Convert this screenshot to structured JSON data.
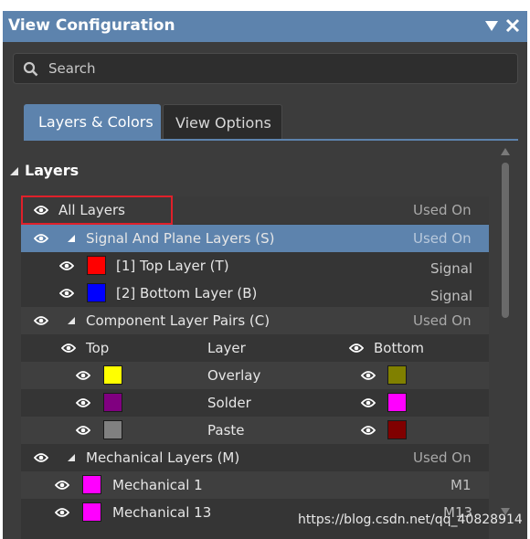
{
  "window": {
    "title": "View Configuration",
    "dropdown_icon": "triangle-down-icon",
    "close_icon": "close-icon"
  },
  "search": {
    "placeholder": "Search",
    "icon": "search-icon"
  },
  "tabs": [
    {
      "label": "Layers & Colors",
      "active": true
    },
    {
      "label": "View Options",
      "active": false
    }
  ],
  "section": {
    "label": "Layers"
  },
  "all_layers": {
    "label": "All Layers",
    "right": "Used On"
  },
  "signal_group": {
    "label": "Signal And Plane Layers (S)",
    "right": "Used On",
    "items": [
      {
        "label": "[1] Top Layer (T)",
        "color": "#ff0000",
        "type": "Signal"
      },
      {
        "label": "[2] Bottom Layer (B)",
        "color": "#0000ff",
        "type": "Signal"
      }
    ]
  },
  "component_group": {
    "label": "Component Layer Pairs (C)",
    "right": "Used On",
    "headers": {
      "top": "Top",
      "layer": "Layer",
      "bottom": "Bottom"
    },
    "pairs": [
      {
        "layer": "Overlay",
        "top_color": "#ffff00",
        "bottom_color": "#808000"
      },
      {
        "layer": "Solder",
        "top_color": "#800080",
        "bottom_color": "#ff00ff"
      },
      {
        "layer": "Paste",
        "top_color": "#808080",
        "bottom_color": "#800000"
      }
    ]
  },
  "mechanical_group": {
    "label": "Mechanical Layers (M)",
    "right": "Used On",
    "items": [
      {
        "label": "Mechanical 1",
        "color": "#ff00ff",
        "code": "M1"
      },
      {
        "label": "Mechanical 13",
        "color": "#ff00ff",
        "code": "M13"
      }
    ]
  },
  "colors": {
    "accent": "#5d83ad",
    "panel": "#3c3c3c",
    "highlight_border": "#e0202a"
  },
  "watermark": "https://blog.csdn.net/qq_40828914"
}
